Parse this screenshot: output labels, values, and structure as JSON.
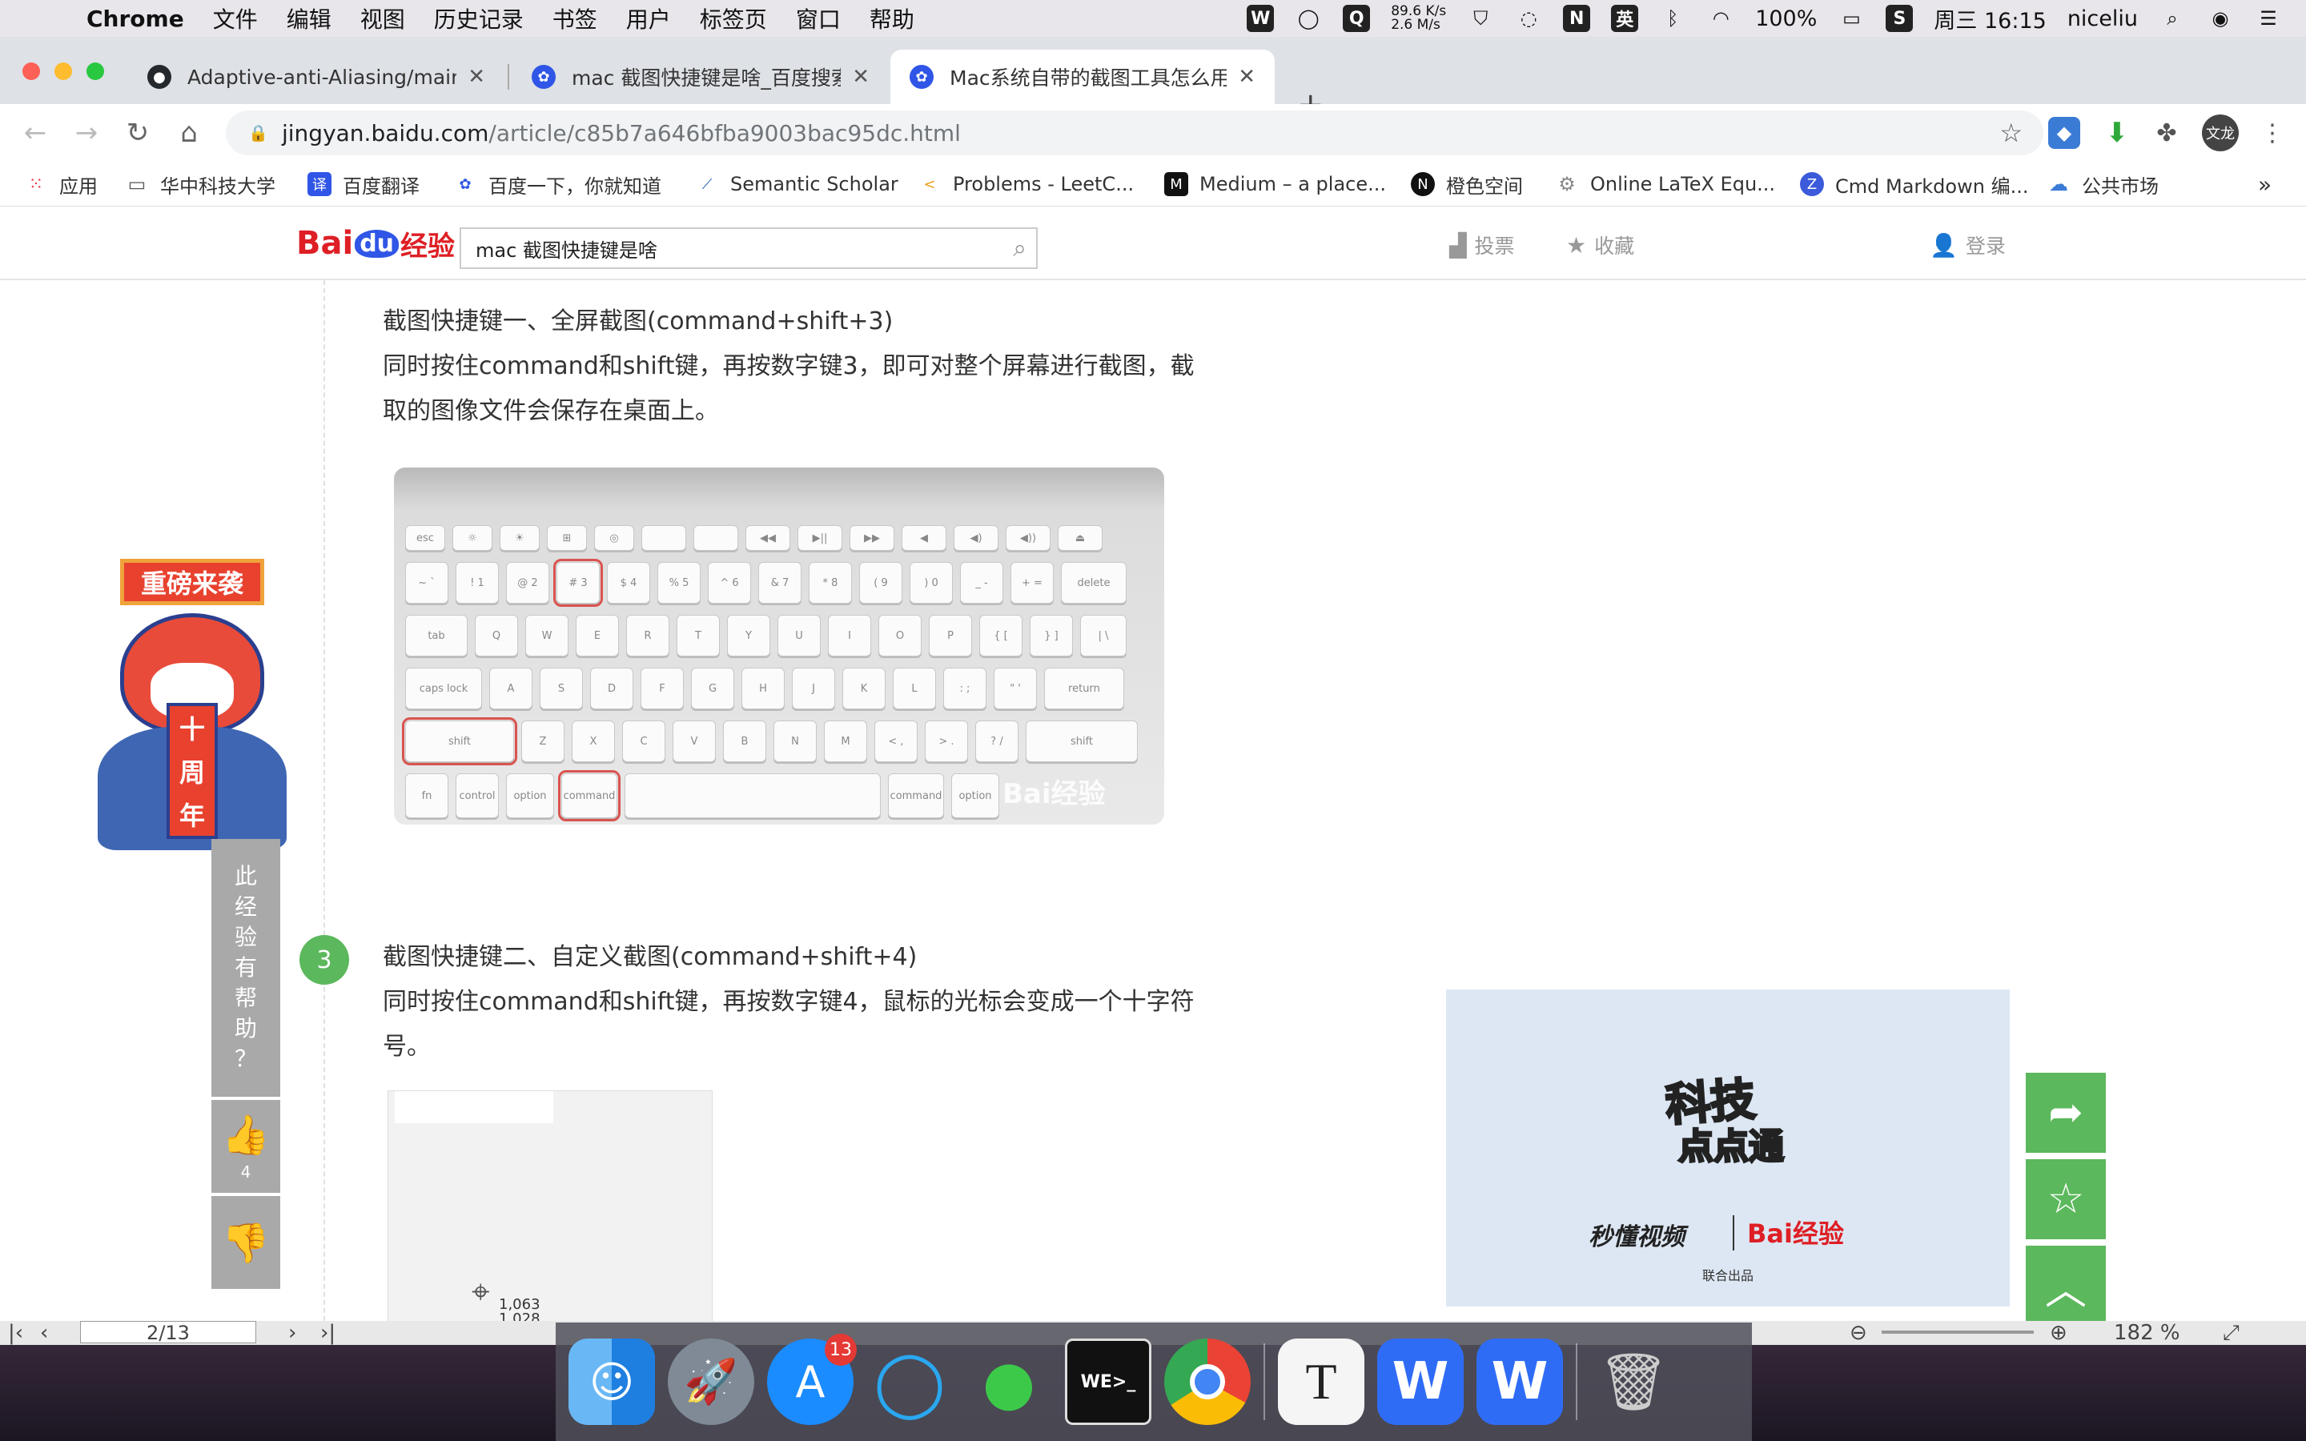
{
  "menubar": {
    "app_name": "Chrome",
    "menus": [
      "文件",
      "编辑",
      "视图",
      "历史记录",
      "书签",
      "用户",
      "标签页",
      "窗口",
      "帮助"
    ],
    "net_up": "89.6 K/s",
    "net_down": "2.6 M/s",
    "input_method": "英",
    "battery": "100%",
    "clock": "周三 16:15",
    "user": "niceliu"
  },
  "tabs": [
    {
      "title": "Adaptive-anti-Aliasing/main.py",
      "icon": "github-icon"
    },
    {
      "title": "mac 截图快捷键是啥_百度搜索",
      "icon": "baidu-paw-icon"
    },
    {
      "title": "Mac系统自带的截图工具怎么用,",
      "icon": "baidu-paw-icon"
    }
  ],
  "address": {
    "host": "jingyan.baidu.com",
    "path": "/article/c85b7a646bfba9003bac95dc.html"
  },
  "profile_label": "文龙",
  "bookmarks": [
    {
      "label": "应用",
      "icon": "apps-grid-icon"
    },
    {
      "label": "华中科技大学",
      "icon": "folder-icon"
    },
    {
      "label": "百度翻译",
      "icon": "baidu-translate-icon"
    },
    {
      "label": "百度一下，你就知道",
      "icon": "baidu-paw-icon"
    },
    {
      "label": "Semantic Scholar",
      "icon": "semantic-scholar-icon"
    },
    {
      "label": "Problems - LeetC...",
      "icon": "leetcode-icon"
    },
    {
      "label": "Medium – a place...",
      "icon": "medium-icon"
    },
    {
      "label": "橙色空间",
      "icon": "notion-icon"
    },
    {
      "label": "Online LaTeX Equ...",
      "icon": "gear-icon"
    },
    {
      "label": "Cmd Markdown 编...",
      "icon": "cmd-markdown-icon"
    },
    {
      "label": "公共市场",
      "icon": "cloud-icon"
    }
  ],
  "site": {
    "logo_bai": "Bai",
    "logo_du": "du",
    "logo_jy": "经验",
    "search_value": "mac 截图快捷键是啥",
    "vote_label": "投票",
    "collect_label": "收藏",
    "login_label": "登录"
  },
  "article": {
    "step2_title": "截图快捷键一、全屏截图(command+shift+3)",
    "step2_line1": "同时按住command和shift键，再按数字键3，即可对整个屏幕进行截图，截",
    "step2_line2": "取的图像文件会保存在桌面上。",
    "step3_number": "3",
    "step3_title": "截图快捷键二、自定义截图(command+shift+4)",
    "step3_line1": "同时按住command和shift键，再按数字键4，鼠标的光标会变成一个十字符",
    "step3_line2": "号。",
    "keyboard_watermark": "Bai经验",
    "coords_x": "1,063",
    "coords_y": "1,028"
  },
  "promo": {
    "title": "重磅来袭",
    "scroll_chars": [
      "十",
      "周",
      "年"
    ]
  },
  "feedback": {
    "question_chars": [
      "此",
      "经",
      "验",
      "有",
      "帮",
      "助",
      "？"
    ],
    "like_count": "4"
  },
  "ad": {
    "title": "科技",
    "subtitle": "点点通",
    "brand1": "秒懂视频",
    "brand2": "Bai经验",
    "footer": "联合出品"
  },
  "keyboard": {
    "row1": [
      "esc",
      "☼",
      "☀",
      "⊞",
      "◎",
      "",
      "",
      "◀◀",
      "▶||",
      "▶▶",
      "◀",
      "◀)",
      "◀))",
      "⏏"
    ],
    "row2": [
      "~ `",
      "! 1",
      "@ 2",
      "# 3",
      "$ 4",
      "% 5",
      "^ 6",
      "& 7",
      "* 8",
      "( 9",
      ") 0",
      "_ -",
      "+ =",
      "delete"
    ],
    "row3": [
      "tab",
      "Q",
      "W",
      "E",
      "R",
      "T",
      "Y",
      "U",
      "I",
      "O",
      "P",
      "{ [",
      "} ]",
      "| \\"
    ],
    "row4": [
      "caps lock",
      "A",
      "S",
      "D",
      "F",
      "G",
      "H",
      "J",
      "K",
      "L",
      ": ;",
      "\" '",
      "return"
    ],
    "row5": [
      "shift",
      "Z",
      "X",
      "C",
      "V",
      "B",
      "N",
      "M",
      "< ,",
      "> .",
      "? /",
      "shift"
    ],
    "row6": [
      "fn",
      "control",
      "option",
      "command",
      "",
      "command",
      "option"
    ]
  },
  "under_window": {
    "page_indicator": "2/13",
    "zoom": "182 %"
  },
  "dock": {
    "appstore_badge": "13",
    "apps": [
      "finder-icon",
      "launchpad-icon",
      "appstore-icon",
      "qq-icon",
      "wechat-icon",
      "weterm-icon",
      "chrome-icon",
      "typora-icon",
      "wps-icon",
      "wps-icon",
      "trash-icon"
    ]
  },
  "colors": {
    "accent_green": "#5cb85c",
    "baidu_red": "#de1f25",
    "baidu_blue": "#2f56e6",
    "highlight_red": "#d9534f"
  }
}
